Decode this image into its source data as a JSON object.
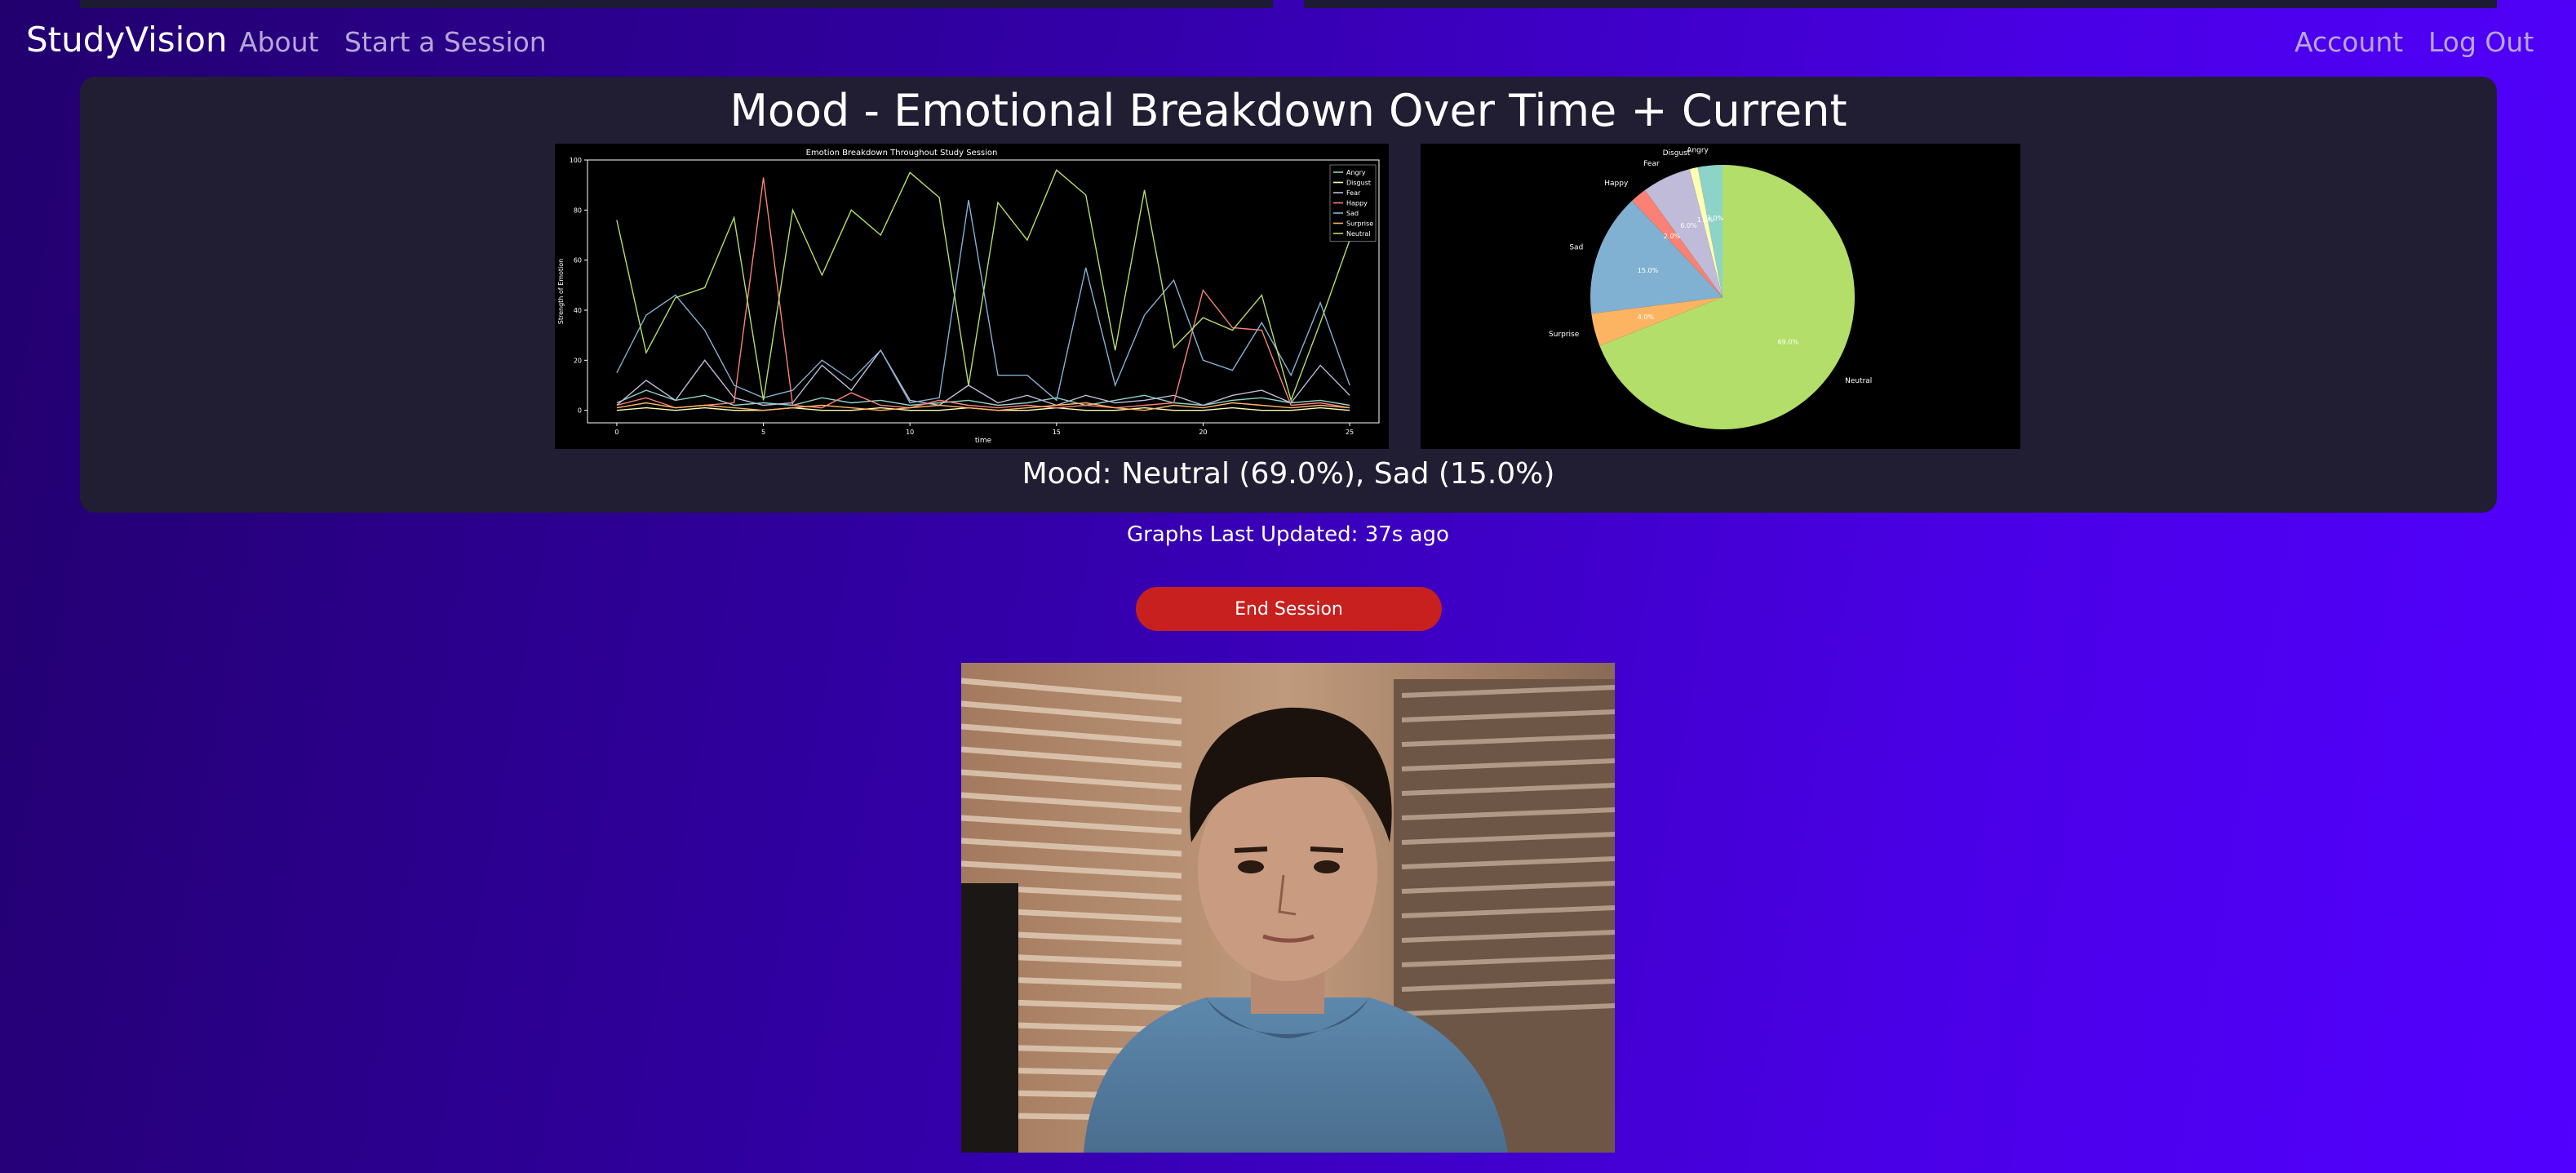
{
  "nav": {
    "brand": "StudyVision",
    "about": "About",
    "start_session": "Start a Session",
    "account": "Account",
    "logout": "Log Out"
  },
  "mood": {
    "title": "Mood - Emotional Breakdown Over Time + Current",
    "summary": "Mood: Neutral (69.0%), Sad (15.0%)"
  },
  "updated_text": "Graphs Last Updated: 37s ago",
  "end_session_label": "End Session",
  "chart_data": [
    {
      "type": "line",
      "title": "Emotion Breakdown Throughout Study Session",
      "xlabel": "time",
      "ylabel": "Strength of Emotion",
      "xlim": [
        -1,
        26
      ],
      "ylim": [
        -5,
        100
      ],
      "xticks": [
        0,
        5,
        10,
        15,
        20,
        25
      ],
      "yticks": [
        0,
        20,
        40,
        60,
        80,
        100
      ],
      "legend_position": "top-right",
      "x": [
        0,
        1,
        2,
        3,
        4,
        5,
        6,
        7,
        8,
        9,
        10,
        11,
        12,
        13,
        14,
        15,
        16,
        17,
        18,
        19,
        20,
        21,
        22,
        23,
        24,
        25
      ],
      "series": [
        {
          "name": "Angry",
          "color": "#8dd3c7",
          "values": [
            3,
            8,
            4,
            6,
            2,
            3,
            2,
            5,
            3,
            4,
            2,
            3,
            4,
            2,
            3,
            5,
            2,
            4,
            6,
            3,
            2,
            4,
            5,
            3,
            4,
            2
          ]
        },
        {
          "name": "Disgust",
          "color": "#feffb3",
          "values": [
            0,
            1,
            0,
            1,
            0,
            0,
            1,
            0,
            0,
            1,
            0,
            0,
            1,
            0,
            0,
            1,
            0,
            0,
            1,
            0,
            0,
            1,
            0,
            0,
            1,
            0
          ]
        },
        {
          "name": "Fear",
          "color": "#bfbbd9",
          "values": [
            2,
            12,
            4,
            20,
            5,
            2,
            3,
            18,
            8,
            24,
            4,
            2,
            10,
            3,
            6,
            2,
            6,
            3,
            4,
            6,
            2,
            6,
            8,
            3,
            18,
            6
          ]
        },
        {
          "name": "Happy",
          "color": "#fa8174",
          "values": [
            2,
            5,
            1,
            2,
            3,
            93,
            2,
            1,
            7,
            2,
            1,
            4,
            2,
            1,
            2,
            1,
            2,
            1,
            2,
            3,
            48,
            33,
            32,
            2,
            3,
            1
          ]
        },
        {
          "name": "Sad",
          "color": "#81b1d2",
          "values": [
            15,
            38,
            46,
            32,
            10,
            5,
            8,
            20,
            12,
            24,
            3,
            5,
            84,
            14,
            14,
            4,
            57,
            10,
            38,
            52,
            20,
            16,
            35,
            14,
            43,
            10
          ]
        },
        {
          "name": "Surprise",
          "color": "#fdb462",
          "values": [
            1,
            3,
            1,
            2,
            1,
            0,
            1,
            2,
            1,
            0,
            1,
            2,
            1,
            0,
            1,
            2,
            3,
            1,
            0,
            2,
            1,
            3,
            2,
            1,
            2,
            1
          ]
        },
        {
          "name": "Neutral",
          "color": "#b3de69",
          "values": [
            76,
            23,
            45,
            49,
            77,
            4,
            80,
            54,
            80,
            70,
            95,
            85,
            10,
            83,
            68,
            96,
            86,
            24,
            88,
            25,
            37,
            32,
            46,
            4,
            35,
            68
          ]
        }
      ]
    },
    {
      "type": "pie",
      "slices": [
        {
          "label": "Angry",
          "value": 3.0,
          "pct_label": "3.0%",
          "color": "#8dd3c7"
        },
        {
          "label": "Disgust",
          "value": 1.0,
          "pct_label": "1.0%",
          "color": "#feffb3"
        },
        {
          "label": "Fear",
          "value": 6.0,
          "pct_label": "6.0%",
          "color": "#bfbbd9"
        },
        {
          "label": "Happy",
          "value": 2.0,
          "pct_label": "2.0%",
          "color": "#fa8174"
        },
        {
          "label": "Sad",
          "value": 15.0,
          "pct_label": "15.0%",
          "color": "#81b1d2"
        },
        {
          "label": "Surprise",
          "value": 4.0,
          "pct_label": "4.0%",
          "color": "#fdb462"
        },
        {
          "label": "Neutral",
          "value": 69.0,
          "pct_label": "69.0%",
          "color": "#b3de69"
        }
      ]
    }
  ]
}
